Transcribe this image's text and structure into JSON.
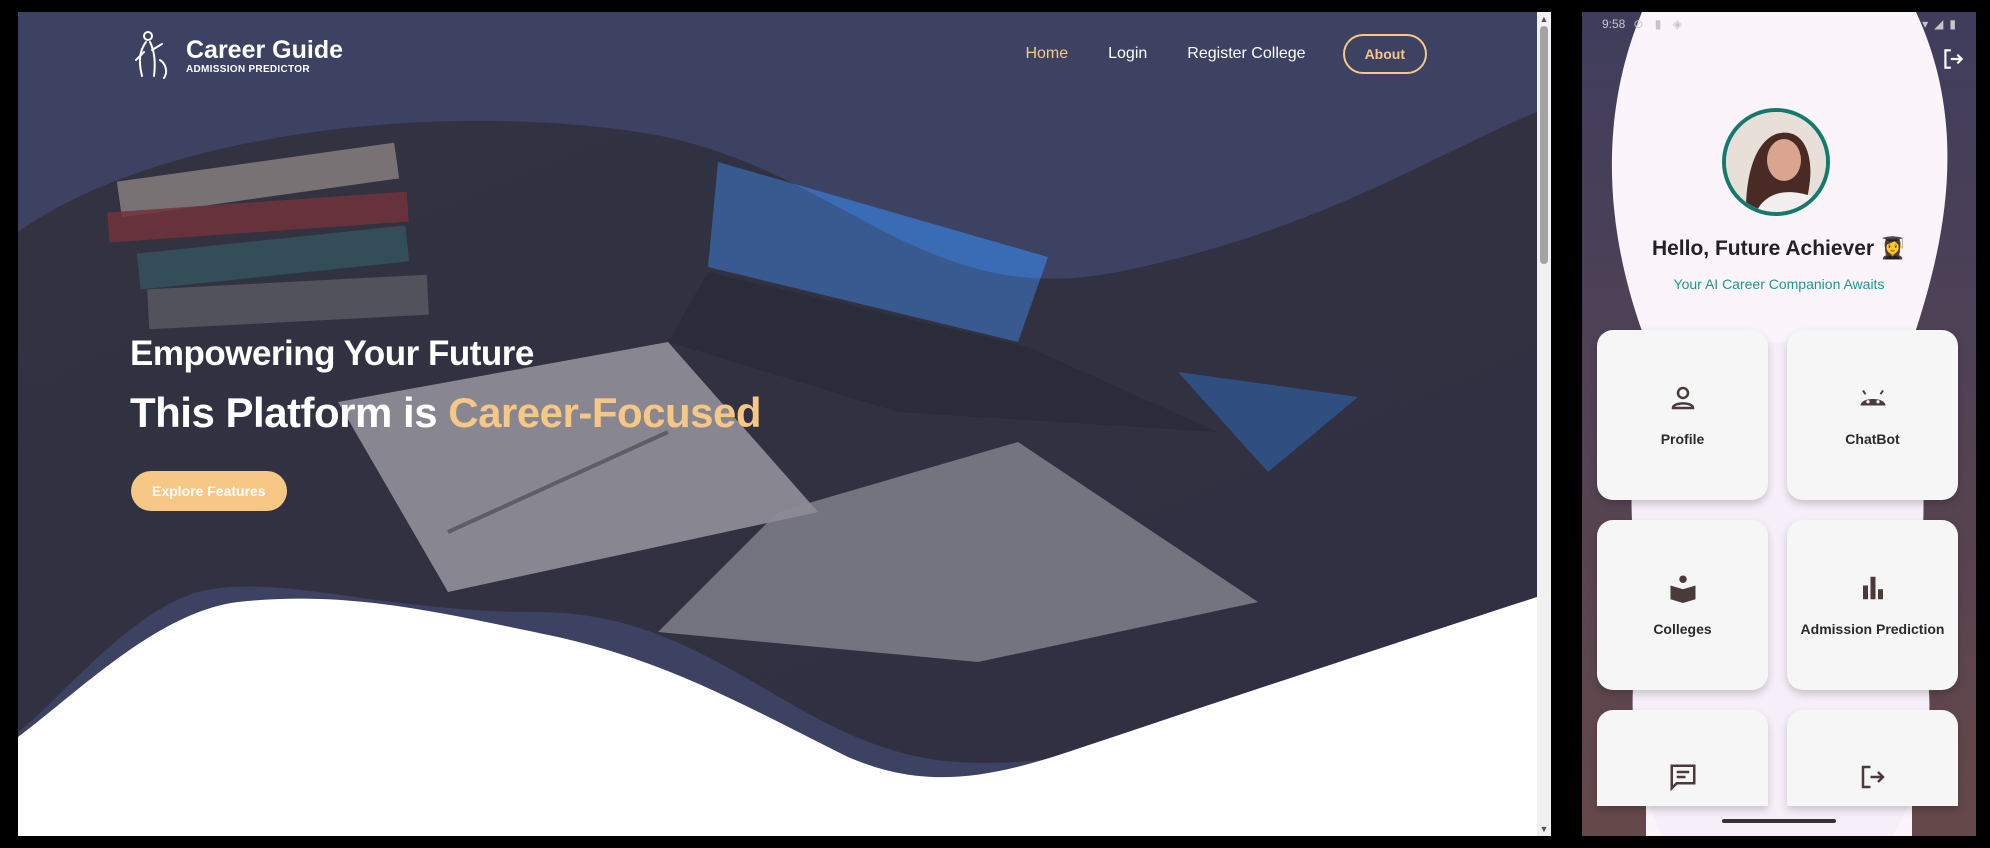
{
  "site": {
    "brand_title": "Career Guide",
    "brand_subtitle": "ADMISSION PREDICTOR",
    "nav": [
      "Home",
      "Login",
      "Register College"
    ],
    "about_label": "About",
    "headline_line1": "Empowering Your Future",
    "headline_line2_prefix": "This Platform is ",
    "headline_line2_accent": "Career-Focused",
    "cta_label": "Explore Features",
    "accent_color": "#f6c785",
    "hero_overlay_color": "#3b3f5a"
  },
  "phone": {
    "status_time": "9:58",
    "greeting": "Hello, Future Achiever 👩‍🎓",
    "tagline": "Your AI Career Companion Awaits",
    "cards": [
      {
        "label": "Profile",
        "icon": "person-icon"
      },
      {
        "label": "ChatBot",
        "icon": "android-icon"
      },
      {
        "label": "Colleges",
        "icon": "book-reader-icon"
      },
      {
        "label": "Admission Prediction",
        "icon": "bar-chart-icon"
      },
      {
        "label": "",
        "icon": "message-icon"
      },
      {
        "label": "",
        "icon": "exit-icon"
      }
    ],
    "teal_color": "#1a9a8c"
  }
}
